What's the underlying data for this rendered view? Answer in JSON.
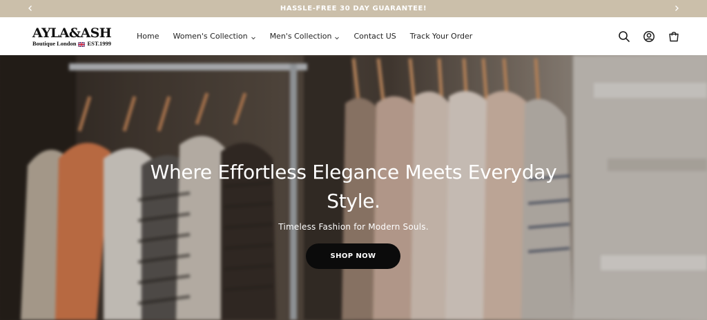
{
  "announcement": {
    "text": "HASSLE-FREE 30 DAY GUARANTEE!",
    "prev_icon": "chevron-left-icon",
    "next_icon": "chevron-right-icon"
  },
  "brand": {
    "name": "AYLA&ASH",
    "tagline_left": "Boutique London",
    "tagline_right": "EST.1999",
    "flag_icon": "uk-flag-icon"
  },
  "nav": {
    "items": [
      {
        "label": "Home",
        "has_dropdown": false
      },
      {
        "label": "Women's Collection",
        "has_dropdown": true
      },
      {
        "label": "Men's Collection",
        "has_dropdown": true
      },
      {
        "label": "Contact US",
        "has_dropdown": false
      },
      {
        "label": "Track Your Order",
        "has_dropdown": false
      }
    ]
  },
  "header_icons": [
    "search-icon",
    "account-icon",
    "cart-icon"
  ],
  "hero": {
    "title": "Where Effortless Elegance Meets Everyday Style.",
    "subtitle": "Timeless Fashion for Modern Souls.",
    "cta_label": "SHOP NOW"
  },
  "colors": {
    "announcement_bg": "#cbbfaa",
    "cta_bg": "#0b0b0b",
    "text_on_hero": "#ffffff"
  }
}
